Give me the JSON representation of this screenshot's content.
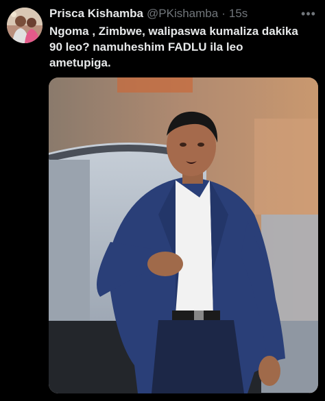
{
  "tweet": {
    "display_name": "Prisca Kishamba",
    "handle": "@PKishamba",
    "separator": "·",
    "time": "15s",
    "more_label": "•••",
    "text": "Ngoma , Zimbwe, walipaswa kumaliza dakika\n90 leo? namuheshim FADLU ila leo\nametupiga."
  },
  "icons": {
    "avatar": "user-avatar",
    "more": "more-horizontal-icon",
    "media": "tweet-photo"
  },
  "colors": {
    "background": "#000000",
    "text_primary": "#e7e9ea",
    "text_secondary": "#71767b",
    "suit": "#2a3f78",
    "shirt": "#f2f2f2"
  }
}
